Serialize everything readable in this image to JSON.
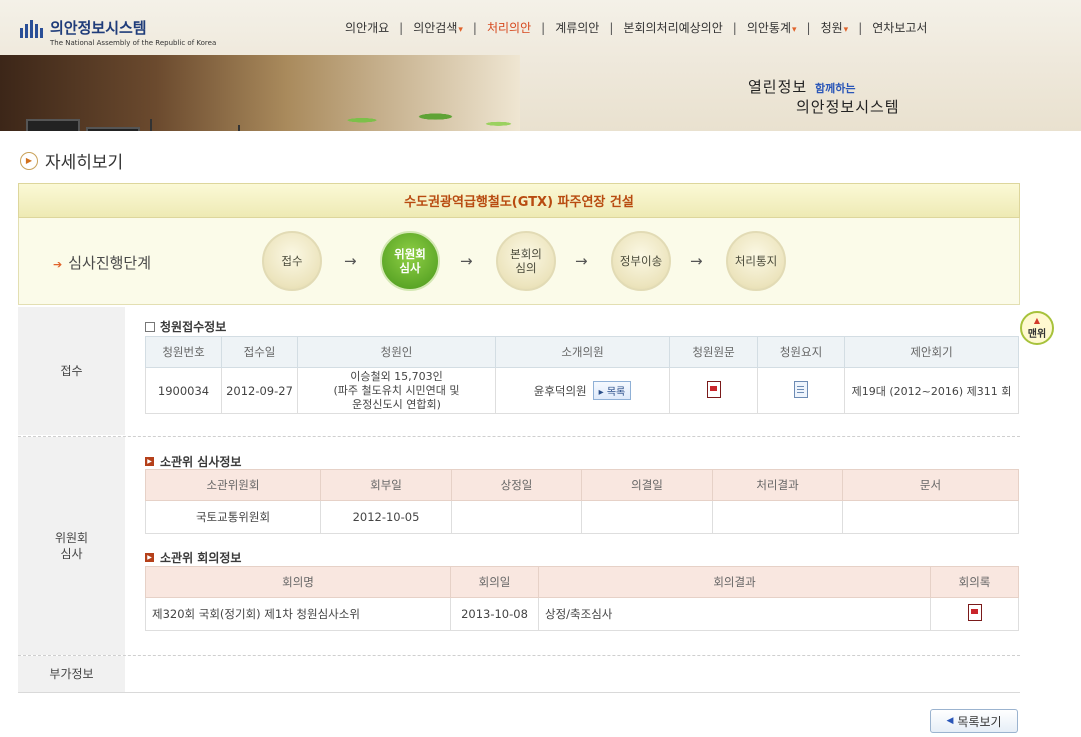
{
  "header": {
    "logo_title": "의안정보시스템",
    "logo_subtitle": "The National Assembly of the Republic of Korea",
    "nav": [
      {
        "label": "의안개요",
        "dropdown": false,
        "active": false
      },
      {
        "label": "의안검색",
        "dropdown": true,
        "active": false
      },
      {
        "label": "처리의안",
        "dropdown": false,
        "active": true
      },
      {
        "label": "계류의안",
        "dropdown": false,
        "active": false
      },
      {
        "label": "본회의처리예상의안",
        "dropdown": false,
        "active": false
      },
      {
        "label": "의안통계",
        "dropdown": true,
        "active": false
      },
      {
        "label": "청원",
        "dropdown": true,
        "active": false
      },
      {
        "label": "연차보고서",
        "dropdown": false,
        "active": false
      }
    ],
    "slogan_main": "열린정보",
    "slogan_with": "함께하는",
    "slogan_system": "의안정보시스템"
  },
  "page_title": "자세히보기",
  "bill_title": "수도권광역급행철도(GTX) 파주연장 건설",
  "stage": {
    "label": "심사진행단계",
    "steps": [
      "접수",
      "위원회\n심사",
      "본회의\n심의",
      "정부이송",
      "처리통지"
    ],
    "current_index": 1
  },
  "reception": {
    "section_label": "접수",
    "heading": "청원접수정보",
    "columns": [
      "청원번호",
      "접수일",
      "청원인",
      "소개의원",
      "청원원문",
      "청원요지",
      "제안회기"
    ],
    "row": {
      "number": "1900034",
      "date": "2012-09-27",
      "petitioner": [
        "이승철외 15,703인",
        "(파주 철도유치 시민연대 및",
        "운정신도시 연합회)"
      ],
      "introducer": "윤후덕의원",
      "list_button": "목록",
      "session": "제19대 (2012~2016) 제311 회"
    }
  },
  "committee": {
    "section_label": "위원회\n심사",
    "review_heading": "소관위 심사정보",
    "review_columns": [
      "소관위원회",
      "회부일",
      "상정일",
      "의결일",
      "처리결과",
      "문서"
    ],
    "review_row": [
      "국토교통위원회",
      "2012-10-05",
      "",
      "",
      "",
      ""
    ],
    "meeting_heading": "소관위 회의정보",
    "meeting_columns": [
      "회의명",
      "회의일",
      "회의결과",
      "회의록"
    ],
    "meeting_row": {
      "name": "제320회 국회(정기회) 제1차 청원심사소위",
      "date": "2013-10-08",
      "result": "상정/축조심사"
    }
  },
  "additional": {
    "section_label": "부가정보"
  },
  "top_button": "맨위",
  "back_button": "목록보기",
  "colors": {
    "accent": "#d6481e",
    "current_step": "#5aa526",
    "title_text": "#b84b10"
  }
}
